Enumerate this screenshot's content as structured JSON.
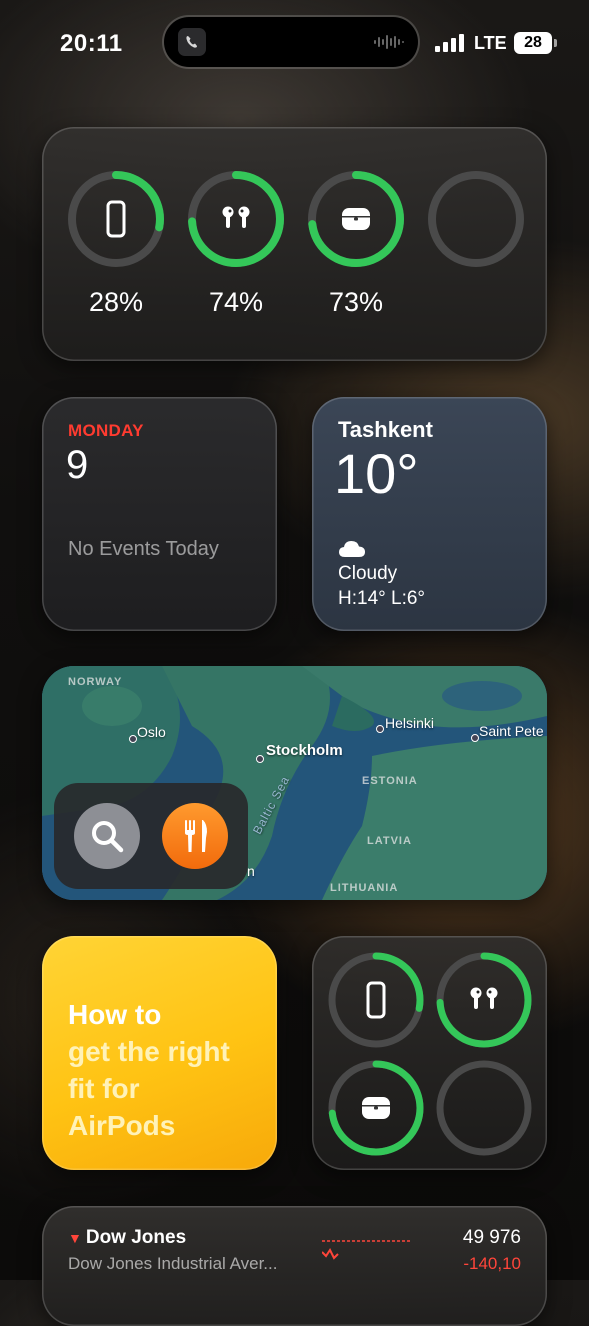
{
  "status_bar": {
    "time": "20:11",
    "network": "LTE",
    "battery": "28"
  },
  "colors": {
    "ring_green": "#34c759",
    "ring_track": "#4a4a4a",
    "calendar_red": "#ff3b30",
    "stock_red": "#ff453a",
    "tips_yellow": "#ffc313"
  },
  "batteries_widget": {
    "devices": [
      {
        "name": "iPhone",
        "icon": "iphone-icon",
        "percent": "28%",
        "level": 0.28
      },
      {
        "name": "AirPods",
        "icon": "airpods-icon",
        "percent": "74%",
        "level": 0.74
      },
      {
        "name": "AirPods case",
        "icon": "airpods-case-icon",
        "percent": "73%",
        "level": 0.73
      },
      {
        "name": "Empty slot",
        "icon": "",
        "percent": "",
        "level": 0
      }
    ]
  },
  "calendar_widget": {
    "weekday": "MONDAY",
    "date": "9",
    "empty_message": "No Events Today"
  },
  "weather_widget": {
    "city": "Tashkent",
    "temperature": "10°",
    "icon": "cloud-icon",
    "condition": "Cloudy",
    "high_low": "H:14° L:6°"
  },
  "map_widget": {
    "cities": [
      "Oslo",
      "Stockholm",
      "Helsinki",
      "Saint Pete"
    ],
    "countries": [
      "NORWAY",
      "ESTONIA",
      "LATVIA",
      "LITHUANIA"
    ],
    "sea": "Baltic Sea",
    "partial_label": "n",
    "actions": [
      {
        "name": "search",
        "icon": "magnifier-icon"
      },
      {
        "name": "restaurants",
        "icon": "fork-knife-icon"
      }
    ]
  },
  "tips_widget": {
    "line1": "How to",
    "line2": "get the right",
    "line3": "fit for",
    "line4": "AirPods"
  },
  "batteries_small_widget": {
    "devices": [
      {
        "name": "iPhone",
        "icon": "iphone-icon",
        "level": 0.28
      },
      {
        "name": "AirPods",
        "icon": "airpods-icon",
        "level": 0.74
      },
      {
        "name": "AirPods case",
        "icon": "airpods-case-icon",
        "level": 0.73
      },
      {
        "name": "Empty slot",
        "icon": "",
        "level": 0
      }
    ]
  },
  "stocks_widget": {
    "symbol": "Dow Jones",
    "full_name": "Dow Jones Industrial Aver...",
    "price": "49 976",
    "change": "-140,10",
    "direction": "down"
  }
}
